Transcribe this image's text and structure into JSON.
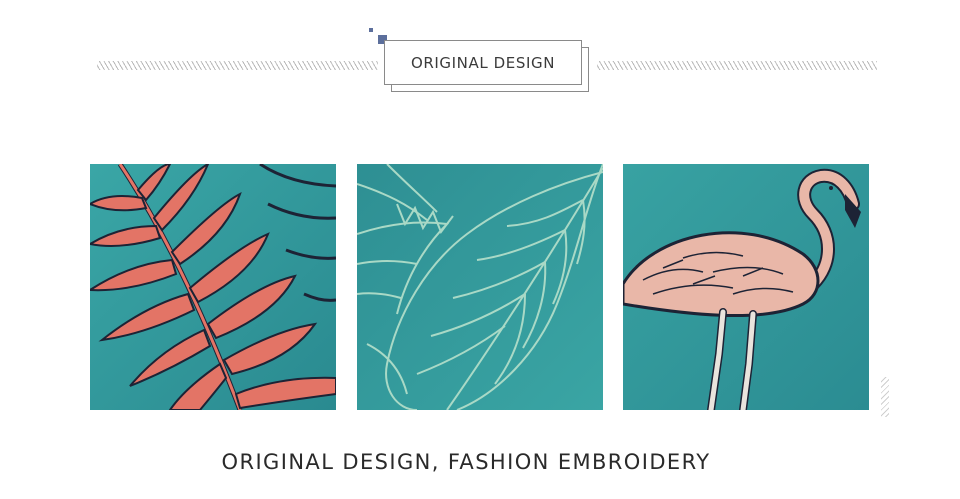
{
  "header": {
    "title": "ORIGINAL DESIGN"
  },
  "caption": "ORIGINAL DESIGN, FASHION EMBROIDERY",
  "colors": {
    "fabric_teal": "#2f9698",
    "leaf_pink": "#e37466",
    "leaf_outline_mint": "#a9d9c6",
    "flamingo_pink": "#e9b7a8",
    "outline_navy": "#1d2335",
    "accent_square": "#5c6f9c"
  },
  "photos": [
    {
      "subject": "pink palm leaf embroidery on teal fabric"
    },
    {
      "subject": "mint outline monstera leaf embroidery on teal fabric"
    },
    {
      "subject": "pink flamingo embroidery on teal fabric"
    }
  ]
}
